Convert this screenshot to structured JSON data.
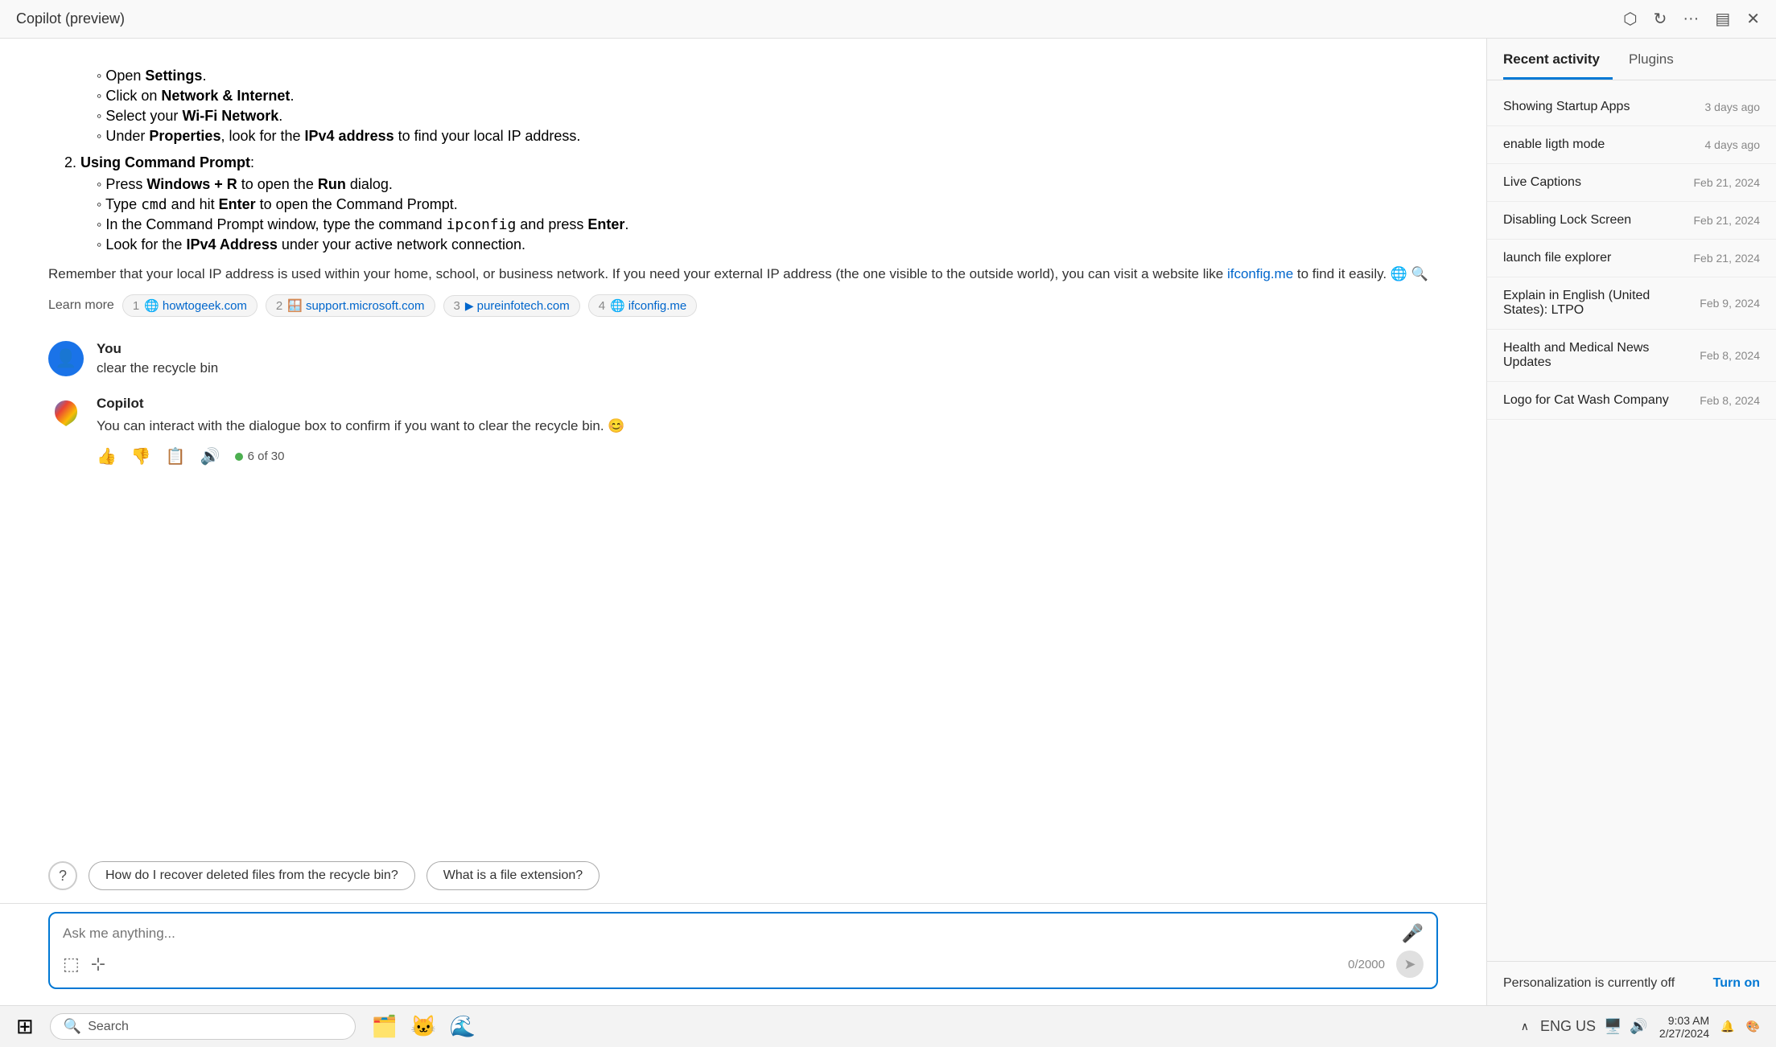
{
  "titleBar": {
    "title": "Copilot (preview)",
    "actions": [
      "open-external-icon",
      "refresh-icon",
      "more-icon",
      "sidebar-icon",
      "close-icon"
    ]
  },
  "chat": {
    "copilotResponse1": {
      "listItems": [
        {
          "text": "Open ",
          "bold": "Settings",
          "suffix": "."
        },
        {
          "text": "Click on ",
          "bold": "Network & Internet",
          "suffix": "."
        },
        {
          "text": "Select your ",
          "bold": "Wi-Fi Network",
          "suffix": "."
        },
        {
          "text": "Under ",
          "bold": "Properties",
          "midtext": ", look for the ",
          "bold2": "IPv4 address",
          "suffix": " to find your local IP address."
        }
      ],
      "section2Title": "Using Command Prompt",
      "section2Items": [
        {
          "text": "Press ",
          "bold": "Windows + R",
          "suffix": " to open the ",
          "bold2": "Run",
          "suffix2": " dialog."
        },
        {
          "text": "Type ",
          "code": "cmd",
          "suffix": " and hit ",
          "bold": "Enter",
          "suffix2": " to open the Command Prompt."
        },
        {
          "text": "In the Command Prompt window, type the command ",
          "code": "ipconfig",
          "suffix": " and press ",
          "bold": "Enter",
          "suffix2": "."
        },
        {
          "text": "Look for the ",
          "bold": "IPv4 Address",
          "suffix": " under your active network connection."
        }
      ],
      "rememberText": "Remember that your local IP address is used within your home, school, or business network. If you need your external IP address (the one visible to the outside world), you can visit a website like ",
      "linkText": "ifconfig.me",
      "rememberSuffix": " to find it easily. 🌐 🔍",
      "learnMoreLabel": "Learn more",
      "sources": [
        {
          "num": "1",
          "icon": "🌐",
          "label": "howtogeek.com",
          "url": "#"
        },
        {
          "num": "2",
          "icon": "🪟",
          "label": "support.microsoft.com",
          "url": "#"
        },
        {
          "num": "3",
          "icon": "▶",
          "label": "pureinfotech.com",
          "url": "#"
        },
        {
          "num": "4",
          "icon": "🌐",
          "label": "ifconfig.me",
          "url": "#"
        }
      ]
    },
    "userMessage": {
      "name": "You",
      "text": "clear the recycle bin"
    },
    "copilotResponse2": {
      "name": "Copilot",
      "text": "You can interact with the dialogue box to confirm if you want to clear the recycle bin. 😊",
      "countLabel": "6 of 30"
    },
    "suggestions": [
      "How do I recover deleted files from the recycle bin?",
      "What is a file extension?"
    ],
    "input": {
      "placeholder": "Ask me anything...",
      "charCount": "0/2000",
      "sendLabel": "➤"
    }
  },
  "sidebar": {
    "tabs": [
      {
        "label": "Recent activity",
        "active": true
      },
      {
        "label": "Plugins",
        "active": false
      }
    ],
    "activities": [
      {
        "title": "Showing Startup Apps",
        "time": "3 days ago"
      },
      {
        "title": "enable ligth mode",
        "time": "4 days ago"
      },
      {
        "title": "Live Captions",
        "time": "Feb 21, 2024"
      },
      {
        "title": "Disabling Lock Screen",
        "time": "Feb 21, 2024"
      },
      {
        "title": "launch file explorer",
        "time": "Feb 21, 2024"
      },
      {
        "title": "Explain in English (United States): LTPO",
        "time": "Feb 9, 2024"
      },
      {
        "title": "Health and Medical News Updates",
        "time": "Feb 8, 2024"
      },
      {
        "title": "Logo for Cat Wash Company",
        "time": "Feb 8, 2024"
      }
    ],
    "personalizationText": "Personalization is currently off",
    "turnOnLabel": "Turn on"
  },
  "taskbar": {
    "searchPlaceholder": "Search",
    "time": "9:03 AM",
    "date": "2/27/2024",
    "lang": "ENG US",
    "apps": [
      "🗂️",
      "🌊"
    ]
  }
}
